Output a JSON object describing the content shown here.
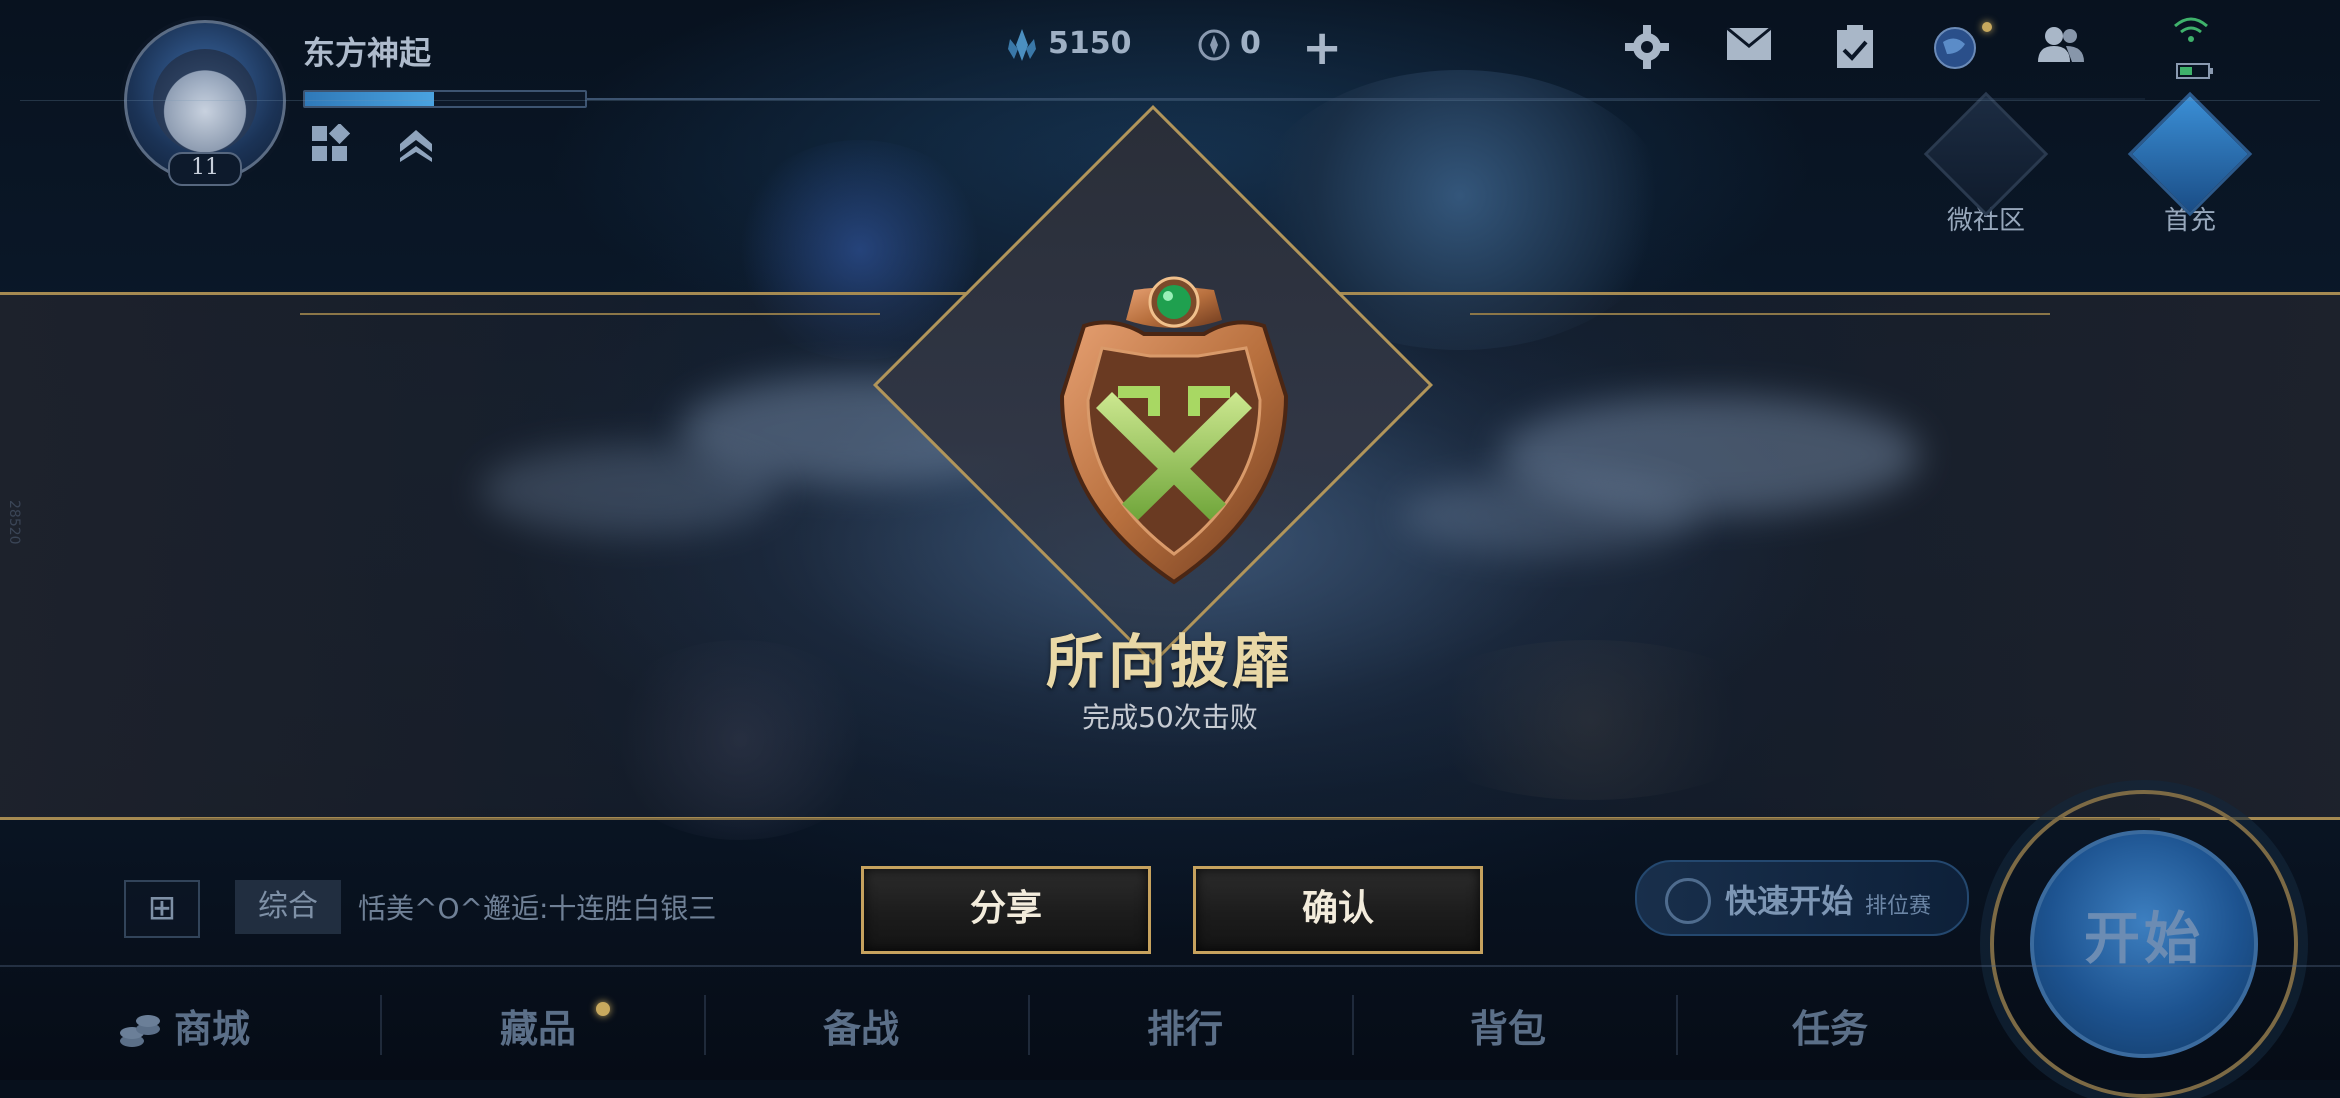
{
  "header": {
    "username": "东方神起",
    "level": "11",
    "currencies": [
      {
        "icon": "crystal-icon",
        "value": "5150"
      },
      {
        "icon": "coupon-icon",
        "value": "0"
      }
    ],
    "add_label": "+",
    "top_icons": [
      "gear-icon",
      "mail-icon",
      "task-board-icon",
      "globe-icon",
      "friends-icon",
      "wifi-icon",
      "battery-icon"
    ],
    "right_buttons": [
      {
        "icon": "community-icon",
        "label": "微社区"
      },
      {
        "icon": "diamond-icon",
        "label": "首充"
      }
    ]
  },
  "achievement": {
    "title": "所向披靡",
    "description": "完成50次击败",
    "share_label": "分享",
    "confirm_label": "确认",
    "badge_icon": "crossed-swords-shield-icon",
    "colors": {
      "gold": "#c6a25e",
      "badge_bronze": "#b8703e",
      "badge_green": "#9ed04f"
    }
  },
  "chat": {
    "tab": "综合",
    "message": "恬美^O^邂逅:十连胜白银三",
    "side_text": "28520"
  },
  "actions": {
    "quick_start_main": "快速开始",
    "quick_start_sub": "排位赛",
    "start_label": "开始"
  },
  "bottom_nav": [
    "商城",
    "藏品",
    "备战",
    "排行",
    "背包",
    "任务"
  ]
}
